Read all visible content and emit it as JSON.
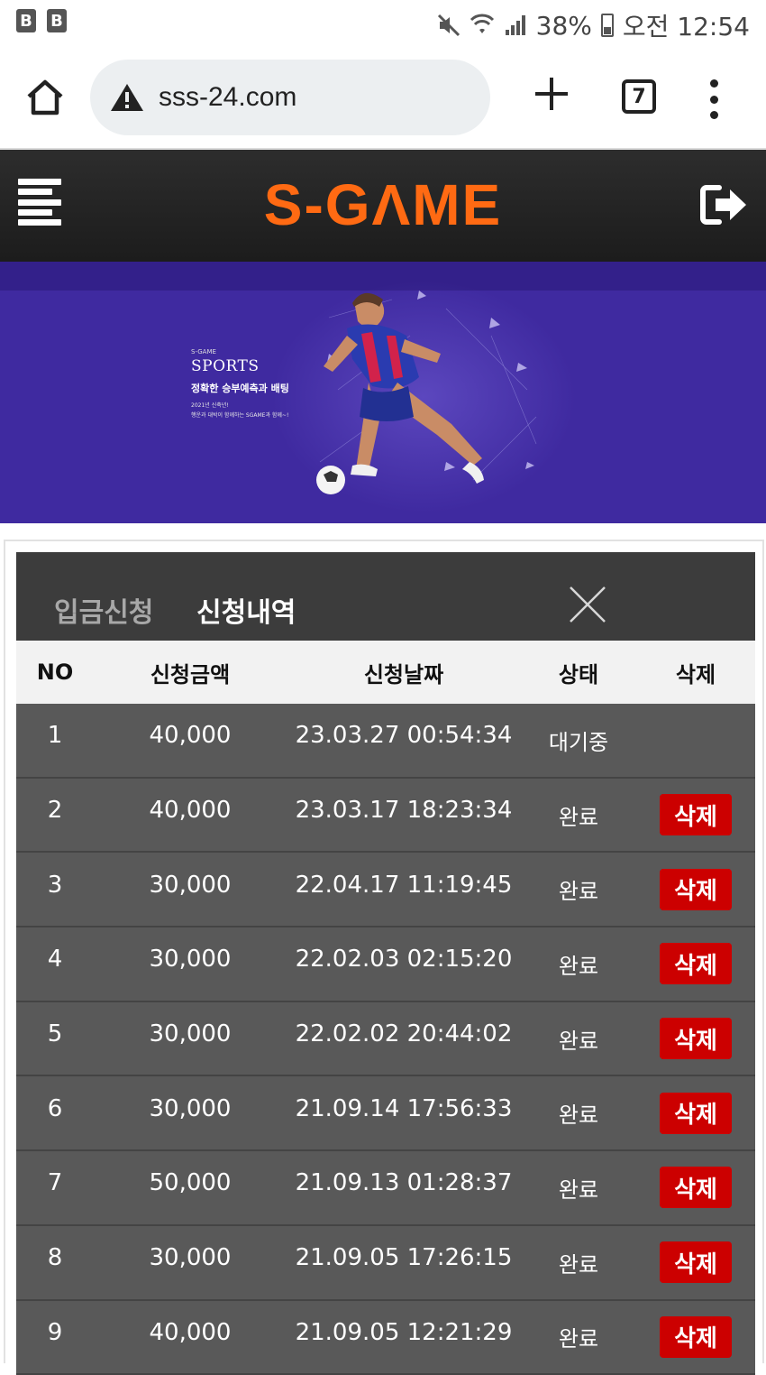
{
  "status_bar": {
    "left_icons": [
      "B",
      "B"
    ],
    "mute_icon": "mute-icon",
    "wifi_icon": "wifi-icon",
    "signal_icon": "signal-icon",
    "battery": "38%",
    "time": "오전 12:54"
  },
  "browser": {
    "url": "sss-24.com",
    "tab_count": "7"
  },
  "site": {
    "logo": "S-GΛME"
  },
  "banner": {
    "small": "S-GAME",
    "title": "SPORTS",
    "subtitle": "정확한 승부예측과 배팅",
    "line1": "2021년 신축년!",
    "line2": "행운과 대박이 함께하는 SGAME과 함께~!"
  },
  "panel": {
    "tabs": [
      "입금신청",
      "신청내역"
    ],
    "columns": [
      "NO",
      "신청금액",
      "신청날짜",
      "상태",
      "삭제"
    ],
    "delete_label": "삭제",
    "rows": [
      {
        "no": "1",
        "amount": "40,000",
        "date": "23.03.27 00:54:34",
        "status": "대기중"
      },
      {
        "no": "2",
        "amount": "40,000",
        "date": "23.03.17 18:23:34",
        "status": "완료"
      },
      {
        "no": "3",
        "amount": "30,000",
        "date": "22.04.17 11:19:45",
        "status": "완료"
      },
      {
        "no": "4",
        "amount": "30,000",
        "date": "22.02.03 02:15:20",
        "status": "완료"
      },
      {
        "no": "5",
        "amount": "30,000",
        "date": "22.02.02 20:44:02",
        "status": "완료"
      },
      {
        "no": "6",
        "amount": "30,000",
        "date": "21.09.14 17:56:33",
        "status": "완료"
      },
      {
        "no": "7",
        "amount": "50,000",
        "date": "21.09.13 01:28:37",
        "status": "완료"
      },
      {
        "no": "8",
        "amount": "30,000",
        "date": "21.09.05 17:26:15",
        "status": "완료"
      },
      {
        "no": "9",
        "amount": "40,000",
        "date": "21.09.05 12:21:29",
        "status": "완료"
      }
    ]
  },
  "colors": {
    "accent": "#ff6a13",
    "delete": "#cc0000",
    "banner": "#3f2aa0"
  }
}
